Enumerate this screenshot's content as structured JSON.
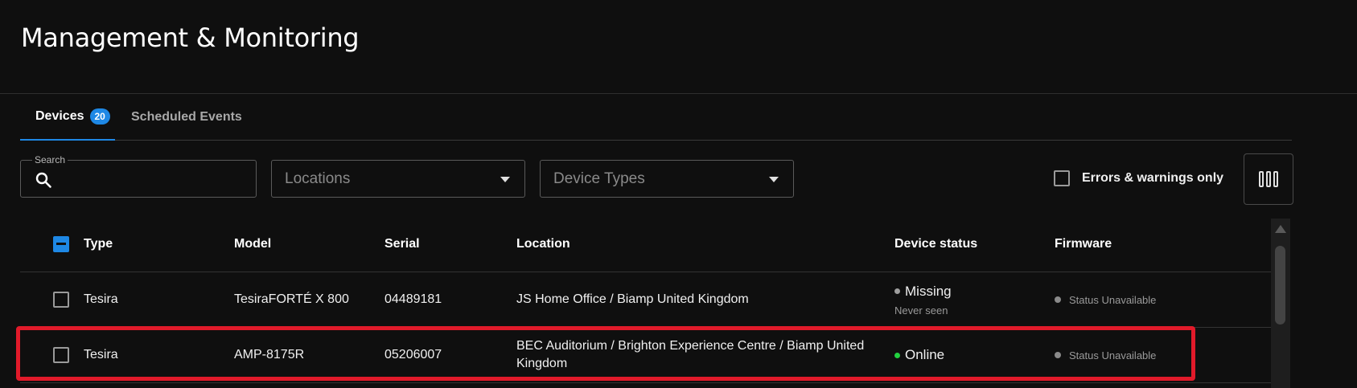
{
  "page": {
    "title": "Management & Monitoring"
  },
  "tabs": [
    {
      "label": "Devices",
      "count": "20"
    },
    {
      "label": "Scheduled Events"
    }
  ],
  "filters": {
    "search_label": "Search",
    "search_value": "",
    "locations_placeholder": "Locations",
    "device_types_placeholder": "Device Types",
    "errors_only_label": "Errors & warnings only"
  },
  "table": {
    "columns": [
      "Type",
      "Model",
      "Serial",
      "Location",
      "Device status",
      "Firmware"
    ],
    "rows": [
      {
        "type": "Tesira",
        "model": "TesiraFORTÉ X 800",
        "serial": "04489181",
        "location": "JS Home Office / Biamp United Kingdom",
        "status": "Missing",
        "status_detail": "Never seen",
        "firmware": "Status Unavailable"
      },
      {
        "type": "Tesira",
        "model": "AMP-8175R",
        "serial": "05206007",
        "location": "BEC Auditorium / Brighton Experience Centre / Biamp United Kingdom",
        "status": "Online",
        "firmware": "Status Unavailable"
      }
    ]
  },
  "colors": {
    "accent": "#1e88e5",
    "online": "#22d13f",
    "highlight": "#e11a2a"
  }
}
